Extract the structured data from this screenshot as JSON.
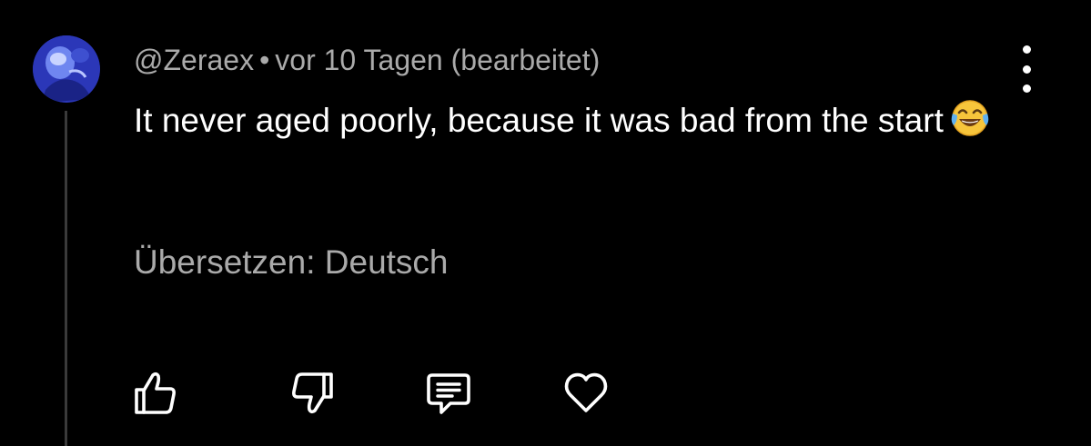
{
  "comment": {
    "author": "@Zeraex",
    "separator": "•",
    "timestamp": "vor 10 Tagen (bearbeitet)",
    "text": "It never aged poorly, because it was bad from the start",
    "emoji": "face-with-tears-of-joy",
    "translate_label": "Übersetzen: Deutsch"
  },
  "actions": {
    "icons": [
      "thumbs-up-icon",
      "thumbs-down-icon",
      "reply-icon",
      "heart-icon"
    ]
  },
  "colors": {
    "background": "#000000",
    "primary_text": "#ffffff",
    "secondary_text": "#aaaaaa",
    "thread_line": "#3a3a3a"
  }
}
